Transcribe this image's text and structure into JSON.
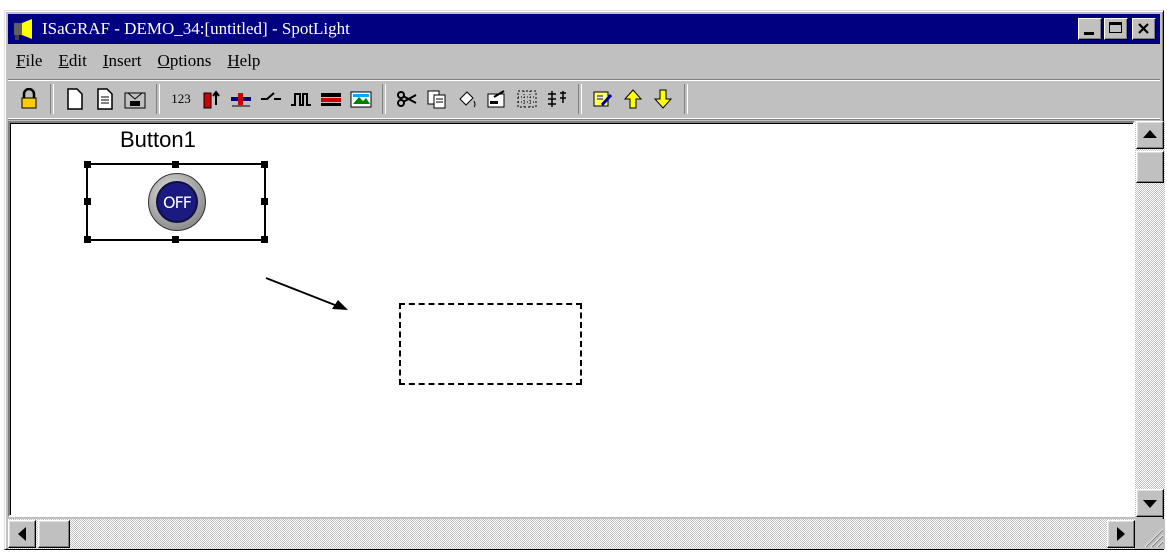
{
  "window": {
    "title": "ISaGRAF - DEMO_34:[untitled] - SpotLight"
  },
  "menu": [
    {
      "label": "File",
      "ul": "F",
      "rest": "ile"
    },
    {
      "label": "Edit",
      "ul": "E",
      "rest": "dit"
    },
    {
      "label": "Insert",
      "ul": "I",
      "rest": "nsert"
    },
    {
      "label": "Options",
      "ul": "O",
      "rest": "ptions"
    },
    {
      "label": "Help",
      "ul": "H",
      "rest": "elp"
    }
  ],
  "toolbar": {
    "numeric_label": "123"
  },
  "canvas": {
    "button_label": "Button1",
    "button_state": "OFF"
  },
  "colors": {
    "titlebar": "#000080",
    "button_face": "#1a1a80"
  }
}
